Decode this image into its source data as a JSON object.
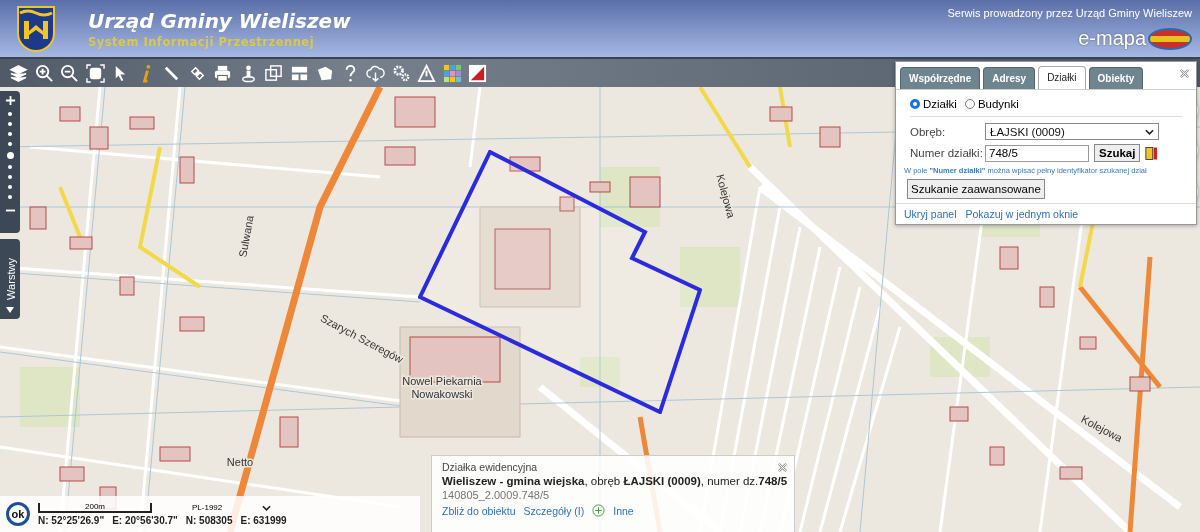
{
  "header": {
    "title": "Urząd Gminy Wieliszew",
    "subtitle": "System Informacji Przestrzennej",
    "service": "Serwis prowadzony przez Urząd Gminy Wieliszew",
    "brand": "e-mapa"
  },
  "zoom_slider": {
    "level": 0.5
  },
  "layers_tab": {
    "label": "Warstwy"
  },
  "map": {
    "labels": [
      {
        "text": "Nowel Piekarnia"
      },
      {
        "text": "Nowakowski"
      },
      {
        "text": "Netto"
      },
      {
        "text": "Kolejowa"
      },
      {
        "text": "Szarych Szeregów"
      },
      {
        "text": "Sulwana"
      },
      {
        "text": "Kolejowa"
      }
    ]
  },
  "search_panel": {
    "tabs": [
      {
        "label": "Współrzędne",
        "selected": false
      },
      {
        "label": "Adresy",
        "selected": false
      },
      {
        "label": "Działki",
        "selected": true
      },
      {
        "label": "Obiekty",
        "selected": false
      }
    ],
    "modes": [
      {
        "label": "Działki",
        "selected": true
      },
      {
        "label": "Budynki",
        "selected": false
      }
    ],
    "district": {
      "label": "Obręb:",
      "value": "ŁAJSKI (0009)"
    },
    "parcel": {
      "label": "Numer działki:",
      "value": "748/5"
    },
    "search_button": "Szukaj",
    "hint": "W pole **\"Numer działki\"** można wpisać pełny identyfikator szukanej dział",
    "advanced_button": "Szukanie zaawansowane",
    "links": [
      "Ukryj panel",
      "Pokazuj w jednym oknie"
    ]
  },
  "info_popup": {
    "title": "Działka ewidencyjna",
    "description": "**Wieliszew - gmina wiejska**, obręb **ŁAJSKI (0009)**, numer dz.**748/5**",
    "identifier": "140805_2.0009.748/5",
    "links": [
      "Zbliż do obiektu",
      "Szczegóły (I)",
      "Inne"
    ]
  },
  "status_bar": {
    "scale": "200m",
    "projection": "PL-1992",
    "coordinates": [
      "N: 52°25'26.9\"",
      "E: 20°56'30.7\"",
      "N: 508305",
      "E: 631999"
    ],
    "badge": "ok"
  }
}
